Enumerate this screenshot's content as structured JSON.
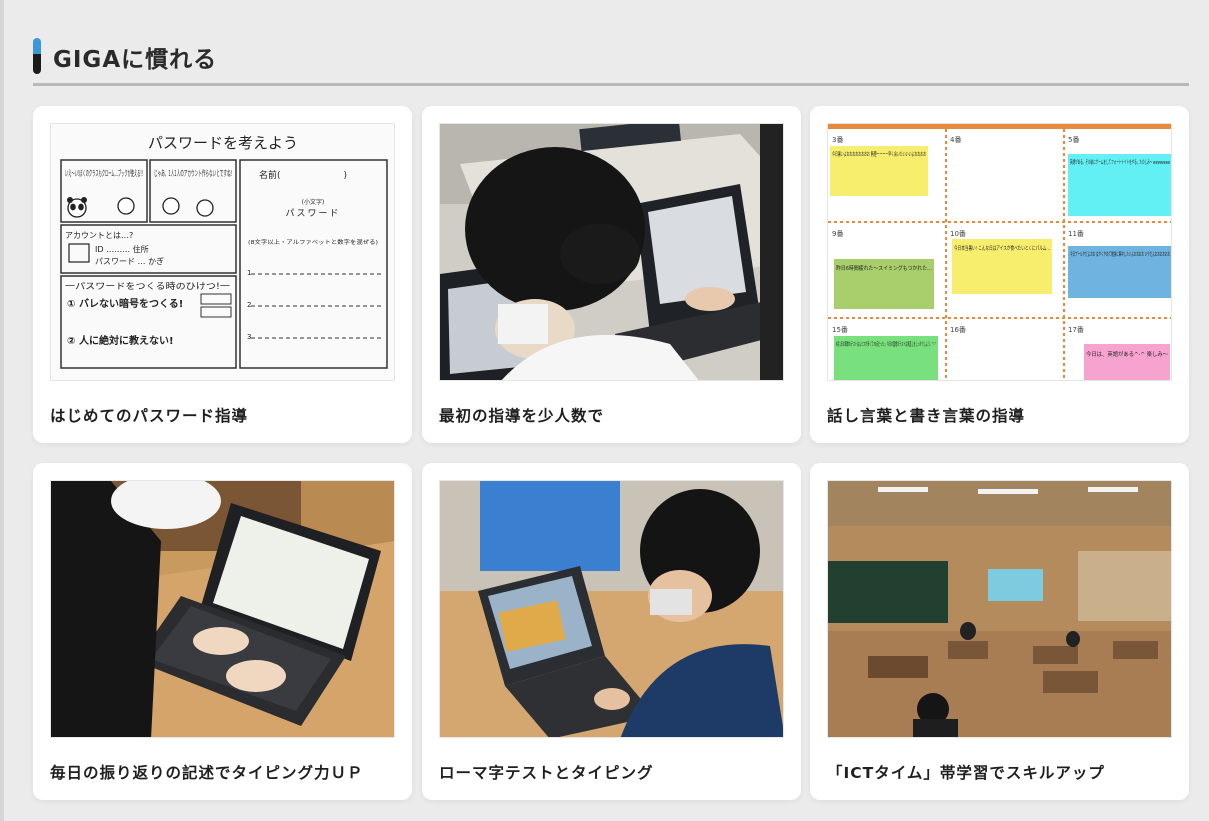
{
  "section": {
    "title": "GIGAに慣れる",
    "accent_color": "#3a9ad9"
  },
  "cards": [
    {
      "title": "はじめてのパスワード指導",
      "worksheet": {
        "heading": "パスワードを考えよう",
        "name_label": "名前(　　　　　　　)",
        "password_label": "パスワード",
        "hint": "(8文字以上・アルファベットと数字を混ぜる)",
        "small_hint": "(小文字)",
        "speech1": "いえ〜い!ぼくのクラスもクローム…ブックが使える!!",
        "speech2": "じゃあ、1人1人のアカウント作らないとですね!",
        "account_label": "アカウントとは…?",
        "id_label": "ID ……… 住所",
        "pw_label": "パスワード … かぎ",
        "tips_heading": "一パスワードをつくる時のひけつ!一",
        "tip1": "① バレない暗号をつくる!",
        "tip2": "② 人に絶対に教えない!"
      }
    },
    {
      "title": "最初の指導を少人数で"
    },
    {
      "title": "話し言葉と書き言葉の指導",
      "calendar": {
        "days": [
          "3番",
          "4番",
          "5番",
          "9番",
          "10番",
          "11番",
          "15番",
          "16番",
          "17番"
        ],
        "notes": [
          "今日暑いよおおおおおおおお 無理ーーーー早く会いたいいいよおおおお",
          "英語がある。その前にゲームをしてフォートナイトをやる。たのしみ〜 wwwwwwww",
          "昨日6時間疲れた〜スイミングもつかれた…",
          "今日本当暑い! こんな日はアイスが食べたいとくにパルム…",
          "今日プールやだよおお はやくやめて勉強に集中したいよおおおお いやだよおおおおおお",
          "6月1日の算数のテストはんミスが多くて76点だった;-; 今日の国語のテストは見直しをしっかりしよう。^-^",
          "今日は、英語がある^-^ 楽しみ〜"
        ]
      }
    },
    {
      "title": "毎日の振り返りの記述でタイピング力ＵＰ"
    },
    {
      "title": "ローマ字テストとタイピング"
    },
    {
      "title": "「ICTタイム」帯学習でスキルアップ"
    }
  ]
}
